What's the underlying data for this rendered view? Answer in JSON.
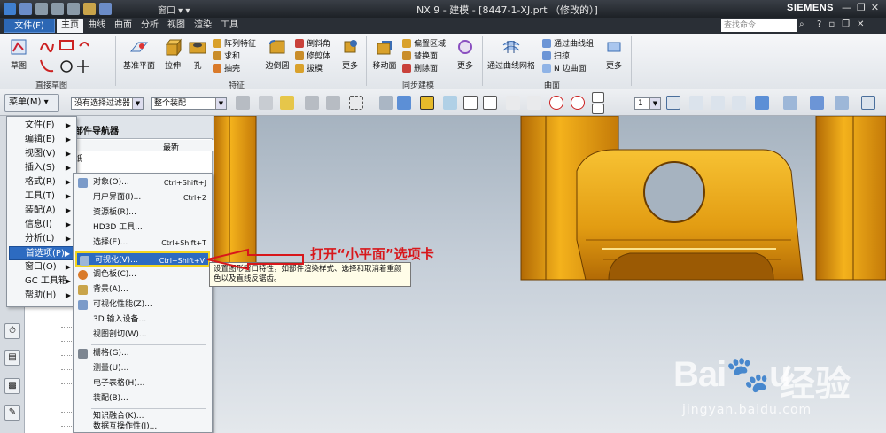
{
  "titlebar": {
    "window_menu": "窗口 ▾ ▾",
    "title": "NX 9 - 建模 - [8447-1-XJ.prt （修改的）]",
    "brand": "SIEMENS",
    "min": "—",
    "restore": "❐",
    "close": "✕"
  },
  "tabbar": {
    "file": "文件(F)",
    "tabs": [
      "主页",
      "曲线",
      "曲面",
      "分析",
      "视图",
      "渲染",
      "工具"
    ],
    "search_placeholder": "查找命令"
  },
  "ribbon": {
    "sketch": "草图",
    "direct_sketch_group": "直接草图",
    "datum_plane": "基准平面",
    "extrude": "拉伸",
    "hole": "孔",
    "pattern_feature": "阵列特征",
    "unite": "求和",
    "subtract": "抽壳",
    "edge_blend": "边倒圆",
    "chamfer": "倒斜角",
    "trim_body": "修剪体",
    "draft": "拔模",
    "more": "更多",
    "feature_group": "特征",
    "move_face": "移动面",
    "offset_region": "偏置区域",
    "replace_face": "替换面",
    "delete_face": "删除面",
    "sync_group": "同步建模",
    "through_curve_mesh": "通过曲线网格",
    "through_curves": "通过曲线组",
    "sweep": "扫掠",
    "n_sided": "N 边曲面",
    "surface_group": "曲面"
  },
  "toolbar": {
    "menu": "菜单(M)",
    "filter": "没有选择过滤器",
    "assembly": "整个装配",
    "layer": "1"
  },
  "mainmenu": {
    "items": [
      "文件(F)",
      "编辑(E)",
      "视图(V)",
      "插入(S)",
      "格式(R)",
      "工具(T)",
      "装配(A)",
      "信息(I)",
      "分析(L)",
      "首选项(P)",
      "窗口(O)",
      "GC 工具箱",
      "帮助(H)"
    ]
  },
  "navigator": {
    "title": "部件导航器",
    "col_latest": "最新",
    "row0": "纸"
  },
  "submenu": {
    "items": [
      {
        "label": "对象(O)...",
        "shortcut": "Ctrl+Shift+J"
      },
      {
        "label": "用户界面(I)...",
        "shortcut": "Ctrl+2"
      },
      {
        "label": "资源板(R)...",
        "shortcut": ""
      },
      {
        "label": "HD3D 工具...",
        "shortcut": ""
      },
      {
        "label": "选择(E)...",
        "shortcut": "Ctrl+Shift+T"
      },
      {
        "label": "可视化(V)...",
        "shortcut": "Ctrl+Shift+V"
      },
      {
        "label": "调色板(C)...",
        "shortcut": ""
      },
      {
        "label": "背景(A)...",
        "shortcut": ""
      },
      {
        "label": "可视化性能(Z)...",
        "shortcut": ""
      },
      {
        "label": "3D 输入设备...",
        "shortcut": ""
      },
      {
        "label": "视图剖切(W)...",
        "shortcut": ""
      },
      {
        "label": "栅格(G)...",
        "shortcut": ""
      },
      {
        "label": "测量(U)...",
        "shortcut": ""
      },
      {
        "label": "电子表格(H)...",
        "shortcut": ""
      },
      {
        "label": "装配(B)...",
        "shortcut": ""
      },
      {
        "label": "知识融合(K)...",
        "shortcut": ""
      },
      {
        "label": "数据互操作性(I)...",
        "shortcut": ""
      }
    ]
  },
  "tooltip": {
    "line1": "设置图形窗口特性，如部件渲染样式、选择和取消着重颜",
    "line2": "色以及直线反锯齿。"
  },
  "annotation": "打开“小平面”选项卡",
  "watermark": {
    "logo": "Bai🐾u",
    "cn": "经验",
    "url": "jingyan.baidu.com"
  },
  "colors": {
    "highlight": "#2d6bc1",
    "annotation_red": "#d8171b",
    "part_gold": "#e8a418",
    "callout_yellow": "#f2d420"
  }
}
